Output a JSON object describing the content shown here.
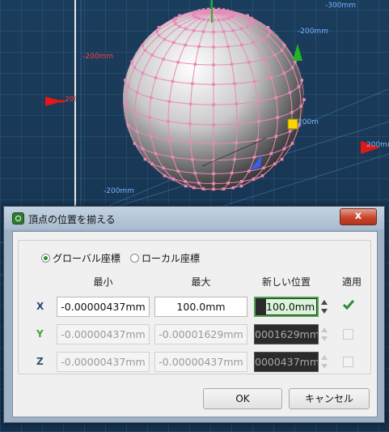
{
  "viewport": {
    "labels": [
      "-300mm",
      "-200mm",
      "-200mm",
      "-200mm",
      "200mm",
      "200mm",
      "200mm"
    ],
    "colors": {
      "background": "#173552",
      "mesh_line": "#e88ab8",
      "axis_x": "#e01818",
      "axis_y": "#22b522",
      "axis_z": "#3a5ef0",
      "handle": "#f5d800"
    }
  },
  "dialog": {
    "title": "頂点の位置を揃える",
    "close_label": "x",
    "coord_mode": {
      "global_label": "グローバル座標",
      "local_label": "ローカル座標",
      "selected": "global"
    },
    "columns": {
      "min": "最小",
      "max": "最大",
      "new_position": "新しい位置",
      "apply": "適用"
    },
    "rows": [
      {
        "axis": "X",
        "axis_color": "#2a4a78",
        "min": "-0.00000437mm",
        "max": "100.0mm",
        "new_position": "100.0mm",
        "apply": true,
        "enabled": true
      },
      {
        "axis": "Y",
        "axis_color": "#3aa83a",
        "min": "-0.00000437mm",
        "max": "-0.00001629mm",
        "new_position": "0001629mm",
        "apply": false,
        "enabled": false
      },
      {
        "axis": "Z",
        "axis_color": "#2a5a6e",
        "min": "-0.00000437mm",
        "max": "-0.00000437mm",
        "new_position": "0000437mm",
        "apply": false,
        "enabled": false
      }
    ],
    "ok_label": "OK",
    "cancel_label": "キャンセル"
  }
}
